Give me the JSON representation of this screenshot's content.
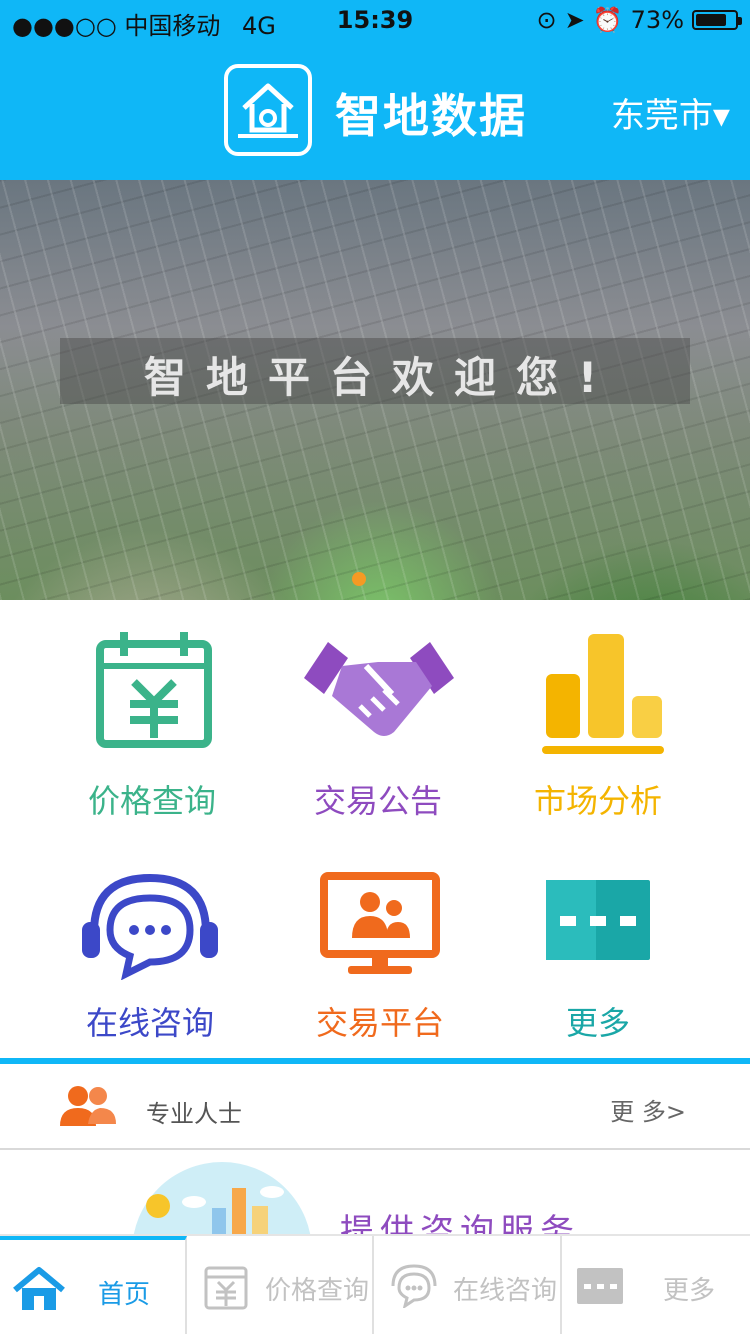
{
  "status_bar": {
    "carrier": "●●●○○ 中国移动",
    "network": "4G",
    "time": "15:39",
    "battery": "73%"
  },
  "header": {
    "title": "智地数据",
    "city": "东莞市▾"
  },
  "banner": {
    "caption": "智地平台欢迎您!",
    "active_slide": 1,
    "slide_indicator_color": "#f59a23"
  },
  "menu": {
    "items": [
      {
        "label": "价格查询",
        "icon": "calendar-yuan-icon",
        "color": "#3bb38a"
      },
      {
        "label": "交易公告",
        "icon": "handshake-icon",
        "color": "#8e4bbf"
      },
      {
        "label": "市场分析",
        "icon": "bar-chart-icon",
        "color": "#f4b400"
      },
      {
        "label": "在线咨询",
        "icon": "headset-chat-icon",
        "color": "#3c48c8"
      },
      {
        "label": "交易平台",
        "icon": "monitor-people-icon",
        "color": "#f06a1d"
      },
      {
        "label": "更多",
        "icon": "more-dots-icon",
        "color": "#1aa7a7"
      }
    ]
  },
  "professionals": {
    "title": "专业人士",
    "more": "更 多>"
  },
  "promo": {
    "text": "提供咨询服务"
  },
  "tabbar": {
    "items": [
      {
        "label": "首页",
        "icon": "home-icon"
      },
      {
        "label": "价格查询",
        "icon": "calendar-yuan-icon"
      },
      {
        "label": "在线咨询",
        "icon": "chat-bubble-icon"
      },
      {
        "label": "更多",
        "icon": "more-dots-icon"
      }
    ],
    "active": "首页",
    "accent": "#0fb7f7"
  }
}
